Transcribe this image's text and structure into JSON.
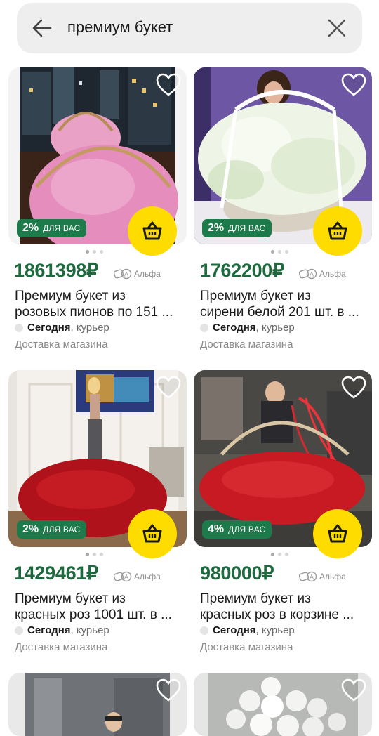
{
  "search": {
    "query": "премиум букет"
  },
  "products": [
    {
      "discount": "2%",
      "for_you": "ДЛЯ ВАС",
      "price": "1861398",
      "currency": "₽",
      "alfa": "Альфа",
      "title_1": "Премиум букет из",
      "title_2": "розовых пионов по 151 ...",
      "delivery_day": "Сегодня",
      "delivery_method": ", курьер",
      "shop": "Доставка магазина"
    },
    {
      "discount": "2%",
      "for_you": "ДЛЯ ВАС",
      "price": "1762200",
      "currency": "₽",
      "alfa": "Альфа",
      "title_1": "Премиум букет из",
      "title_2": "сирени белой 201 шт. в ...",
      "delivery_day": "Сегодня",
      "delivery_method": ", курьер",
      "shop": "Доставка магазина"
    },
    {
      "discount": "2%",
      "for_you": "ДЛЯ ВАС",
      "price": "1429461",
      "currency": "₽",
      "alfa": "Альфа",
      "title_1": "Премиум букет из",
      "title_2": "красных роз 1001 шт. в ...",
      "delivery_day": "Сегодня",
      "delivery_method": ", курьер",
      "shop": "Доставка магазина"
    },
    {
      "discount": "4%",
      "for_you": "ДЛЯ ВАС",
      "price": "980000",
      "currency": "₽",
      "alfa": "Альфа",
      "title_1": "Премиум букет из",
      "title_2": "красных роз в корзине ...",
      "delivery_day": "Сегодня",
      "delivery_method": ", курьер",
      "shop": "Доставка магазина"
    }
  ],
  "colors": {
    "accent_green": "#1d6a3e",
    "badge_green": "#1d7a4a",
    "cart_yellow": "#ffdc00"
  },
  "icons": [
    "back-arrow-icon",
    "close-icon",
    "heart-icon",
    "basket-icon",
    "alfa-logo-icon"
  ]
}
